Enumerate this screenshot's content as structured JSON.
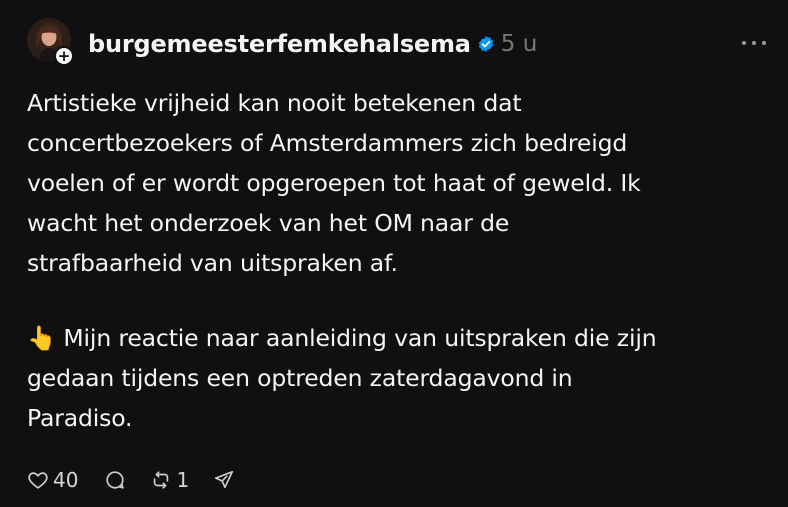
{
  "post": {
    "username": "burgemeesterfemkehalsema",
    "time": "5 u",
    "paragraph1_lines": [
      "Artistieke vrijheid kan nooit betekenen dat",
      "concertbezoekers of Amsterdammers zich bedreigd",
      "voelen of er wordt opgeroepen tot haat of geweld. Ik",
      "wacht het onderzoek van het OM naar de",
      "strafbaarheid van uitspraken af."
    ],
    "paragraph2_lines": [
      "👆 Mijn reactie naar aanleiding van uitspraken die zijn",
      "gedaan tijdens een optreden zaterdagavond in",
      "Paradiso."
    ]
  },
  "actions": {
    "like_count": "40",
    "repost_count": "1"
  },
  "icons": {
    "verified": "verified-badge-icon",
    "follow": "plus-icon",
    "more": "more-options-icon",
    "like": "heart-icon",
    "reply": "comment-icon",
    "repost": "repost-icon",
    "share": "send-icon"
  },
  "colors": {
    "background": "#101010",
    "text": "#f3f5f7",
    "muted": "#777777",
    "verified": "#0095f6"
  }
}
